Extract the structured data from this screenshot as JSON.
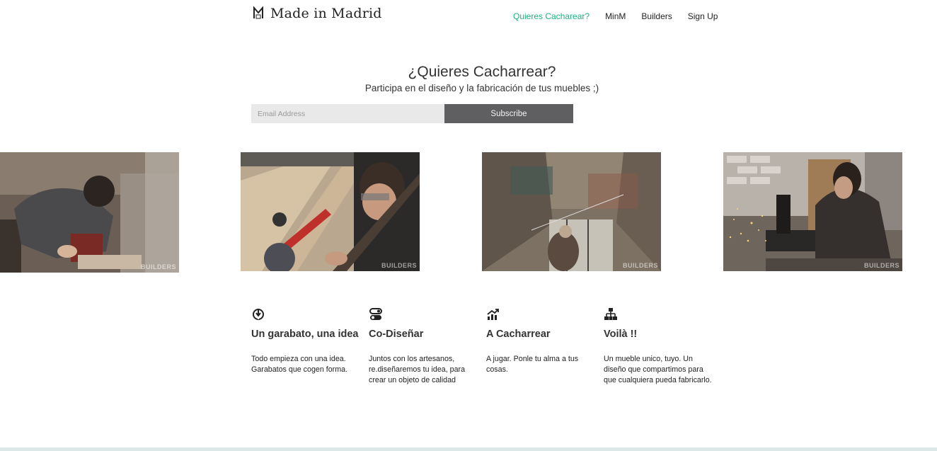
{
  "header": {
    "logo_text": "Made in Madrid",
    "logo_icon": "m-monogram-icon",
    "nav": [
      {
        "label": "Quieres Cacharear?",
        "active": true
      },
      {
        "label": "MinM",
        "active": false
      },
      {
        "label": "Builders",
        "active": false
      },
      {
        "label": "Sign Up",
        "active": false
      }
    ]
  },
  "hero": {
    "title": "¿Quieres Cacharrear?",
    "subtitle": "Participa en el diseño y la fabricación de tus muebles ;)"
  },
  "signup": {
    "email_placeholder": "Email Address",
    "email_value": "",
    "button_label": "Subscribe"
  },
  "gallery": {
    "watermark": "BUILDERS",
    "photos": [
      "router-woodwork-photo",
      "metal-tools-workbench-photo",
      "overhead-welding-photo",
      "grinder-sparks-photo"
    ]
  },
  "features": [
    {
      "icon": "pen-tool-icon",
      "title": "Un garabato, una idea",
      "text": "Todo empieza con una idea. Garabatos que cogen forma."
    },
    {
      "icon": "toggle-switches-icon",
      "title": "Co-Diseñar",
      "text": "Juntos con los artesanos, re.diseñaremos tu idea, para crear un objeto de calidad"
    },
    {
      "icon": "growth-chart-icon",
      "title": "A Cacharrear",
      "text": "A jugar. Ponle tu alma a tus cosas."
    },
    {
      "icon": "hierarchy-icon",
      "title": "Voilà !!",
      "text": "Un mueble unico, tuyo. Un diseño que compartimos para que cualquiera pueda fabricarlo."
    }
  ],
  "colors": {
    "accent": "#19b383",
    "button": "#5f5f62",
    "input_bg": "#e9e9e9",
    "footer_bar": "#dce8e8"
  }
}
